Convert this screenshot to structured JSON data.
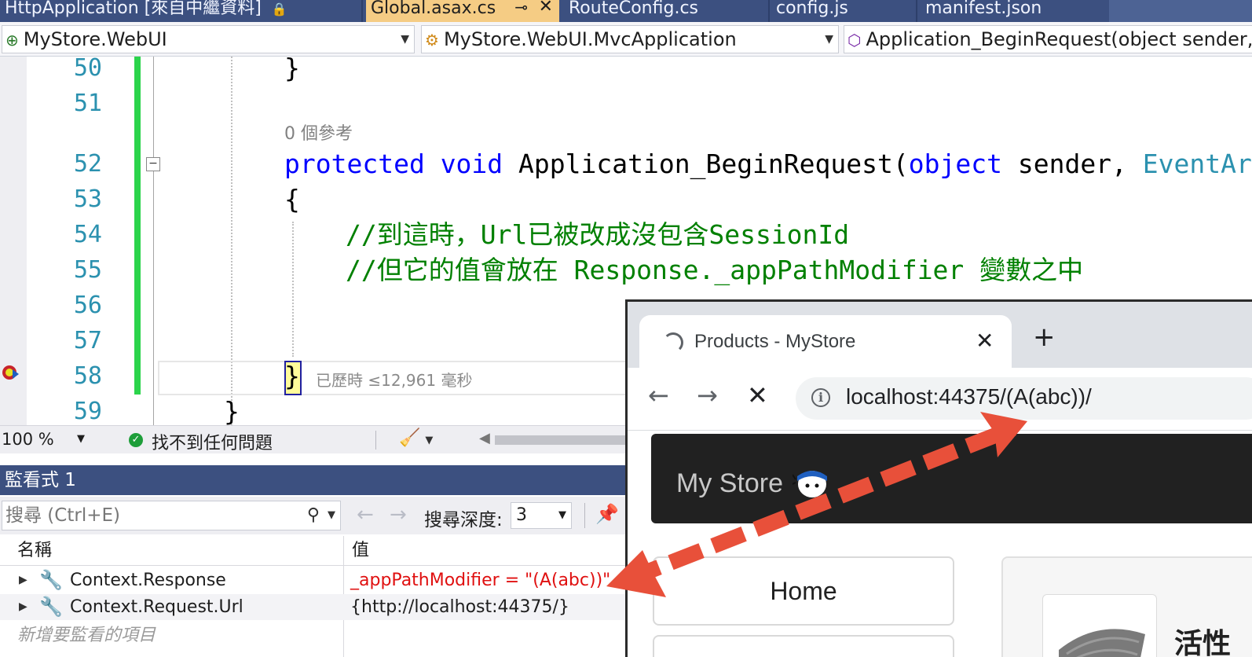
{
  "tabs": [
    {
      "label": "HttpApplication [來自中繼資料]",
      "lock": "🔒"
    },
    {
      "label": "Global.asax.cs",
      "pin": "⊸",
      "close": "✕"
    },
    {
      "label": "RouteConfig.cs"
    },
    {
      "label": "config.js"
    },
    {
      "label": "manifest.json"
    }
  ],
  "navbar": {
    "project": "MyStore.WebUI",
    "class": "MyStore.WebUI.MvcApplication",
    "member": "Application_BeginRequest(object sender,"
  },
  "editor": {
    "line_numbers": [
      "50",
      "51",
      "52",
      "53",
      "54",
      "55",
      "56",
      "57",
      "58",
      "59"
    ],
    "codelens": "0 個參考",
    "line50": "}",
    "line52": {
      "kw1": "protected",
      "kw2": "void",
      "name": "Application_BeginRequest(",
      "kw3": "object",
      "rest": "sender,",
      "type": "EventAr"
    },
    "line53": "{",
    "line54": "//到這時，Url已被改成沒包含SessionId",
    "line55": "//但它的值會放在 Response._appPathModifier 變數之中",
    "line58_brace": "}",
    "perf_tip": "已歷時 ≤12,961 毫秒",
    "line59": "}"
  },
  "status": {
    "zoom": "100 %",
    "ok_icon": "✓",
    "message": "找不到任何問題"
  },
  "watch": {
    "title": "監看式 1",
    "search_placeholder": "搜尋 (Ctrl+E)",
    "depth_label": "搜尋深度:",
    "depth_value": "3",
    "col_name": "名稱",
    "col_value": "值",
    "rows": [
      {
        "name": "Context.Response",
        "value": "_appPathModifier = \"(A(abc))\"",
        "value_color": "#e01010"
      },
      {
        "name": "Context.Request.Url",
        "value": "{http://localhost:44375/}",
        "value_color": "#1e1e1e"
      }
    ],
    "add_item": "新增要監看的項目"
  },
  "browser": {
    "tab_title": "Products - MyStore",
    "tab_close": "✕",
    "new_tab": "+",
    "back": "←",
    "forward": "→",
    "stop": "✕",
    "info": "i",
    "url": "localhost:44375/(A(abc))/",
    "brand": "My Store",
    "home_button": "Home",
    "product_title": "活性"
  },
  "colors": {
    "accent_tab": "#f5cc84",
    "title_bar": "#3c5080",
    "arrow": "#e8503a",
    "change_bar": "#2bd44b"
  }
}
